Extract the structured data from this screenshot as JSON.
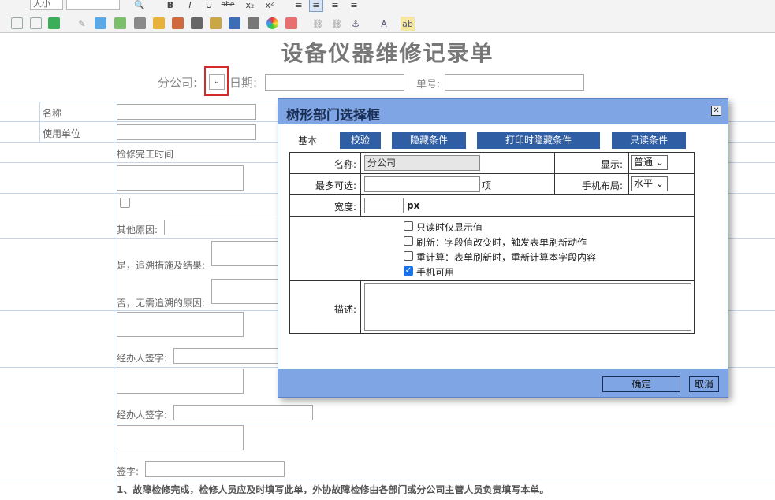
{
  "toolbar": {
    "size_select": "大小",
    "bold": "B",
    "italic": "I",
    "underline": "U",
    "strike": "abe",
    "sub": "x₂",
    "sup": "x²"
  },
  "document": {
    "title": "设备仪器维修记录单",
    "branch_label": "分公司:",
    "date_label": "日期:",
    "number_label": "单号:",
    "rows": {
      "name_label": "名称",
      "unit_label": "使用单位",
      "finish_time_label": "检修完工时间",
      "other_reason_label": "其他原因:",
      "yes_trace_label": "是，追溯措施及结果:",
      "no_trace_label": "否，无需追溯的原因:",
      "handler_sign_label_1": "经办人签字:",
      "handler_sign_label_2": "经办人签字:",
      "sign_label": "签字:"
    },
    "footer_note": "1、故障检修完成，检修人员应及时填写此单，外协故障检修由各部门或分公司主管人员负责填写本单。"
  },
  "dialog": {
    "title": "树形部门选择框",
    "tabs": [
      "基本",
      "校验",
      "隐藏条件",
      "打印时隐藏条件",
      "只读条件"
    ],
    "name_label": "名称:",
    "name_value": "分公司",
    "display_label": "显示:",
    "display_value": "普通",
    "max_label": "最多可选:",
    "max_value": "",
    "max_unit": "项",
    "mobile_layout_label": "手机布局:",
    "mobile_layout_value": "水平",
    "width_label": "宽度:",
    "width_value": "",
    "width_unit": "px",
    "checkboxes": [
      {
        "label": "只读时仅显示值",
        "checked": false
      },
      {
        "label": "刷新：字段值改变时，触发表单刷新动作",
        "checked": false
      },
      {
        "label": "重计算：表单刷新时，重新计算本字段内容",
        "checked": false
      },
      {
        "label": "手机可用",
        "checked": true
      }
    ],
    "desc_label": "描述:",
    "ok_label": "确定",
    "cancel_label": "取消"
  },
  "colors": {
    "dialog_header": "#7fa5e4",
    "tab_active_bg": "#2f5ea4",
    "highlight_box": "#d62b2b"
  }
}
